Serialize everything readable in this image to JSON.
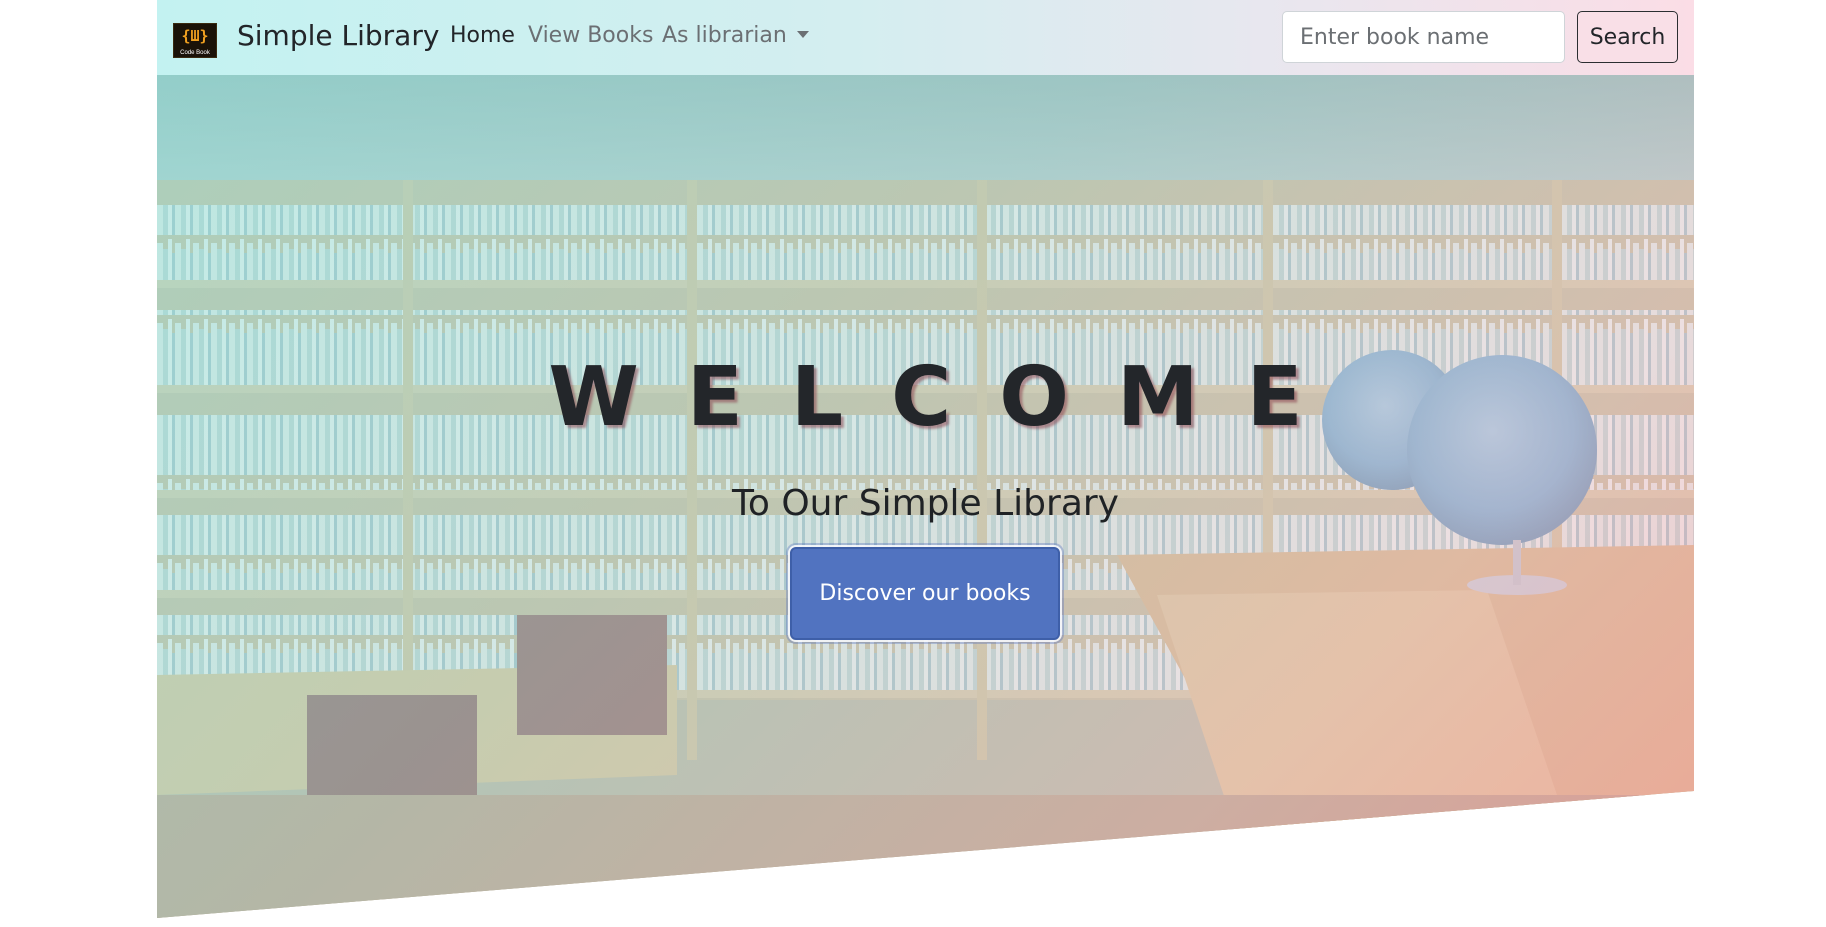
{
  "navbar": {
    "logo": {
      "glyph": "{Ш}",
      "caption": "Code Book"
    },
    "brand": "Simple Library",
    "links": [
      {
        "label": "Home"
      },
      {
        "label": "View Books"
      },
      {
        "label": "As librarian"
      }
    ],
    "search": {
      "placeholder": "Enter book name",
      "value": "",
      "button_label": "Search"
    }
  },
  "hero": {
    "title": "WELCOME",
    "subtitle": "To Our Simple Library",
    "cta_label": "Discover our books"
  },
  "colors": {
    "navbar_left": "#c3f2f1",
    "navbar_right": "#fbdde6",
    "cta_background": "#5173c0",
    "search_button_background": "#f9dfe7"
  }
}
